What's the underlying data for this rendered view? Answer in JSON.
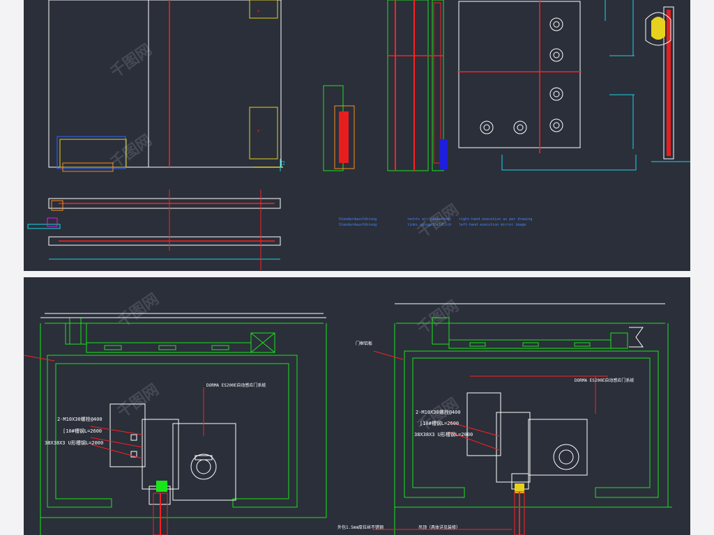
{
  "colors": {
    "background": "#f3f3f5",
    "panel": "#2a2f3a",
    "white": "#ffffff",
    "red": "#ff2020",
    "green": "#19e619",
    "cyan": "#19d6e6",
    "yellow": "#e6d21e",
    "blue": "#3366ff",
    "orange": "#ff8c1a",
    "magenta": "#e619e6"
  },
  "top_panel": {
    "dim_12": "12",
    "notes": {
      "left_line1": "Standardausführung",
      "left_line2": "Standardausführung",
      "mid_line1": "rechts wir gezeichnet",
      "mid_line2": "links spiegelbildlich",
      "right_line1": "right-hand execution as per drawing",
      "right_line2": "left-hand execution mirror image"
    }
  },
  "bottom_panel": {
    "left_drawing": {
      "system_label": "DORMA ES200E自动感应门系统",
      "bolt_label": "2-M10X30螺栓@400",
      "channel_label": "[10#槽钢L=2600",
      "angle_label": "38X38X3 U形槽钢L=2000"
    },
    "right_drawing": {
      "frame_label": "门框铝板",
      "system_label": "DORMA ES200E自动感应门系统",
      "bolt_label": "2-M10X30螺栓@400",
      "channel_label": "[10#槽钢L=2600",
      "angle_label": "38X38X3 U形槽钢L=2000",
      "cladding_label": "外包1.5mm厚拉丝不锈钢",
      "ceiling_label": "吊顶（具体详见装修）"
    }
  },
  "watermark": "千图网"
}
